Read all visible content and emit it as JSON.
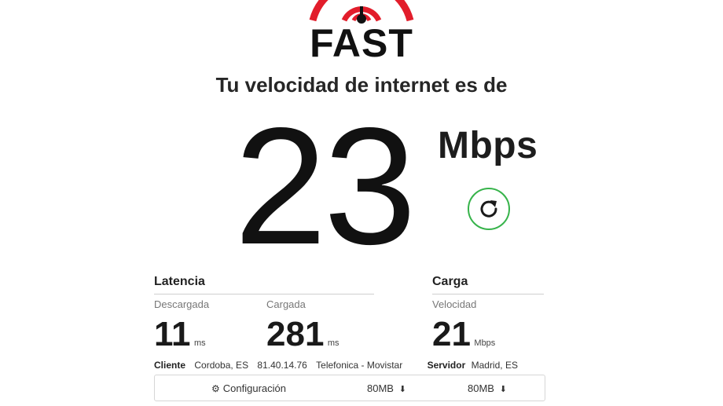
{
  "logo": {
    "text": "FAST"
  },
  "headline": "Tu velocidad de internet es de",
  "speed": {
    "value": "23",
    "unit": "Mbps"
  },
  "latency": {
    "title": "Latencia",
    "unloaded": {
      "label": "Descargada",
      "value": "11",
      "unit": "ms"
    },
    "loaded": {
      "label": "Cargada",
      "value": "281",
      "unit": "ms"
    }
  },
  "upload": {
    "title": "Carga",
    "speed": {
      "label": "Velocidad",
      "value": "21",
      "unit": "Mbps"
    }
  },
  "client": {
    "label": "Cliente",
    "location": "Cordoba, ES",
    "ip": "81.40.14.76",
    "isp": "Telefonica - Movistar"
  },
  "server": {
    "label": "Servidor",
    "location": "Madrid, ES"
  },
  "config": {
    "label": "Configuración",
    "download_size": "80MB",
    "upload_size": "80MB"
  },
  "colors": {
    "brand_red": "#e21d2b",
    "refresh_green": "#36b34a"
  }
}
